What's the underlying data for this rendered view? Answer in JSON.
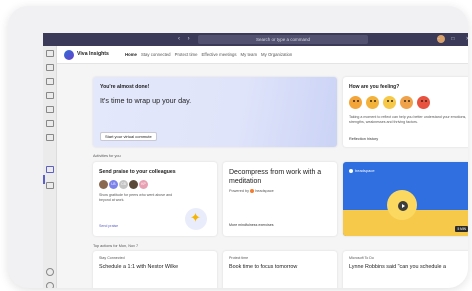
{
  "window": {
    "search_placeholder": "Search or type a command",
    "nav_arrows": "‹ ›",
    "controls": "– □ ✕"
  },
  "app": {
    "name": "Viva Insights",
    "tabs": [
      "Home",
      "Stay connected",
      "Protect time",
      "Effective meetings",
      "My team",
      "My Organization"
    ],
    "more": "···"
  },
  "hero": {
    "title": "You're almost done!",
    "subtitle": "It's time to wrap up your day.",
    "button": "Start your virtual commute"
  },
  "feelings": {
    "title": "How are you feeling?",
    "emoji_colors": [
      "#f3a53a",
      "#f3b23a",
      "#f7c948",
      "#f0a24a",
      "#e8523e"
    ],
    "description": "Taking a moment to reflect can help you better understand your emotions, strengths, weaknesses and thriving factors.",
    "link": "Reflection history"
  },
  "activities_label": "Activities for you",
  "praise": {
    "title": "Send praise to your colleagues",
    "people": [
      {
        "initials": "",
        "color": "#8a6a50"
      },
      {
        "initials": "LB",
        "color": "#7b83eb"
      },
      {
        "initials": "CB",
        "color": "#c4c4c4"
      },
      {
        "initials": "",
        "color": "#5a4a3a"
      },
      {
        "initials": "KP",
        "color": "#e8a0b4"
      }
    ],
    "description": "Show gratitude for peers who went above and beyond at work.",
    "link": "Send praise"
  },
  "meditation": {
    "title": "Decompress from work with a meditation",
    "powered_by": "Powered by",
    "brand": "headspace",
    "link": "More mindfulness exercises"
  },
  "video": {
    "brand": "headspace",
    "duration": "5 MIN"
  },
  "top_actions_label": "Top actions for Mon, Nov 7",
  "actions": [
    {
      "source": "Stay Connected",
      "title": "Schedule a 1:1 with Nestor Wilke"
    },
    {
      "source": "Protect time",
      "title": "Book time to focus tomorrow"
    },
    {
      "source": "Microsoft To Do",
      "title": "Lynne Robbins said \"can you schedule a"
    }
  ]
}
